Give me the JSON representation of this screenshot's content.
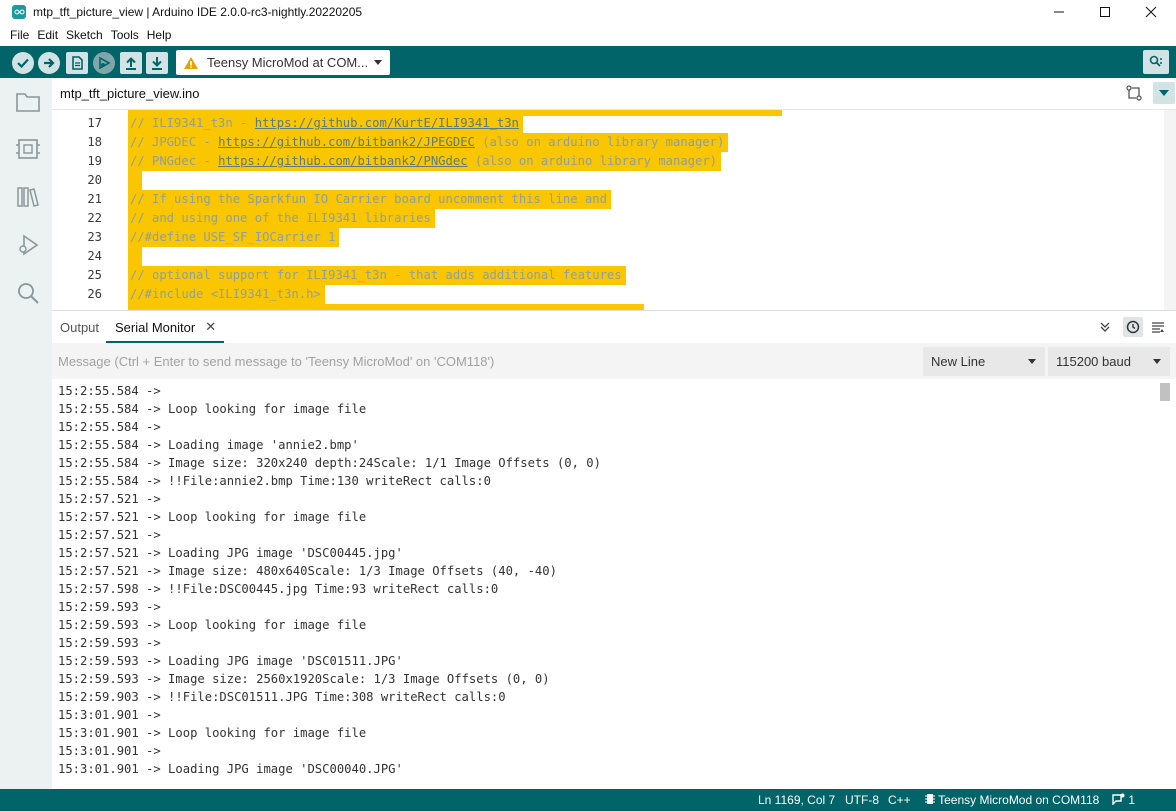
{
  "window": {
    "title": "mtp_tft_picture_view | Arduino IDE 2.0.0-rc3-nightly.20220205",
    "minimize_icon": "minimize-icon",
    "maximize_icon": "maximize-icon",
    "close_icon": "close-icon"
  },
  "menu": [
    "File",
    "Edit",
    "Sketch",
    "Tools",
    "Help"
  ],
  "toolbar": {
    "board": "Teensy MicroMod at COM...",
    "buttons": [
      "verify-icon",
      "upload-icon",
      "new-sketch-icon",
      "debug-icon",
      "open-icon",
      "save-icon"
    ],
    "accent": "#006468"
  },
  "sidebar": {
    "items": [
      "sketchbook-icon",
      "boards-manager-icon",
      "library-manager-icon",
      "debug-icon",
      "search-icon"
    ]
  },
  "editor": {
    "file_tab": "mtp_tft_picture_view.ino",
    "highlight_color": "#f9c600",
    "lines": [
      {
        "num": "17",
        "parts": [
          {
            "t": "// ILI9341_t3n - "
          },
          {
            "t": "https://github.com/KurtE/ILI9341_t3n",
            "url": true
          }
        ]
      },
      {
        "num": "18",
        "parts": [
          {
            "t": "// JPGDEC - "
          },
          {
            "t": "https://github.com/bitbank2/JPEGDEC",
            "url": true
          },
          {
            "t": " (also on arduino library manager)"
          }
        ]
      },
      {
        "num": "19",
        "parts": [
          {
            "t": "// PNGdec - "
          },
          {
            "t": "https://github.com/bitbank2/PNGdec",
            "url": true
          },
          {
            "t": " (also on arduino library manager)"
          }
        ]
      },
      {
        "num": "20",
        "parts": []
      },
      {
        "num": "21",
        "parts": [
          {
            "t": "// If using the Sparkfun IO Carrier board uncomment this line and"
          }
        ]
      },
      {
        "num": "22",
        "parts": [
          {
            "t": "// and using one of the ILI9341 libraries"
          }
        ]
      },
      {
        "num": "23",
        "parts": [
          {
            "t": "//#define USE_SF_IOCarrier 1"
          }
        ]
      },
      {
        "num": "24",
        "parts": []
      },
      {
        "num": "25",
        "parts": [
          {
            "t": "// optional support for ILI9341_t3n - that adds additional features"
          }
        ]
      },
      {
        "num": "26",
        "parts": [
          {
            "t": "//#include <ILI9341_t3n.h>"
          }
        ]
      }
    ]
  },
  "panel": {
    "tabs": {
      "output": "Output",
      "serial_monitor": "Serial Monitor",
      "close": "✕"
    },
    "message_placeholder": "Message (Ctrl + Enter to send message to 'Teensy MicroMod' on 'COM118')",
    "line_ending": "New Line",
    "baud": "115200 baud",
    "serial_lines": [
      "15:2:55.584 ->",
      "15:2:55.584 -> Loop looking for image file",
      "15:2:55.584 ->",
      "15:2:55.584 -> Loading image 'annie2.bmp'",
      "15:2:55.584 -> Image size: 320x240 depth:24Scale: 1/1 Image Offsets (0, 0)",
      "15:2:55.584 -> !!File:annie2.bmp Time:130 writeRect calls:0",
      "15:2:57.521 ->",
      "15:2:57.521 -> Loop looking for image file",
      "15:2:57.521 ->",
      "15:2:57.521 -> Loading JPG image 'DSC00445.jpg'",
      "15:2:57.521 -> Image size: 480x640Scale: 1/3 Image Offsets (40, -40)",
      "15:2:57.598 -> !!File:DSC00445.jpg Time:93 writeRect calls:0",
      "15:2:59.593 ->",
      "15:2:59.593 -> Loop looking for image file",
      "15:2:59.593 ->",
      "15:2:59.593 -> Loading JPG image 'DSC01511.JPG'",
      "15:2:59.593 -> Image size: 2560x1920Scale: 1/3 Image Offsets (0, 0)",
      "15:2:59.903 -> !!File:DSC01511.JPG Time:308 writeRect calls:0",
      "15:3:01.901 ->",
      "15:3:01.901 -> Loop looking for image file",
      "15:3:01.901 ->",
      "15:3:01.901 -> Loading JPG image 'DSC00040.JPG'"
    ]
  },
  "statusbar": {
    "position": "Ln 1169, Col 7",
    "encoding": "UTF-8",
    "language": "C++",
    "board": "Teensy MicroMod on COM118",
    "notifications": "1"
  }
}
